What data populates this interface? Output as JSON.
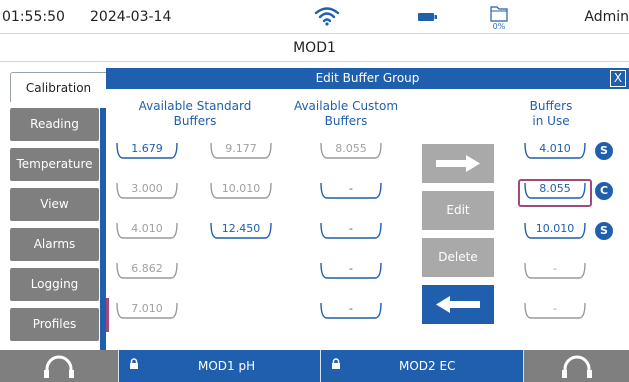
{
  "status": {
    "time": "01:55:50",
    "date": "2024-03-14",
    "storage_pct": "0%",
    "user": "Admin"
  },
  "title": "MOD1",
  "sidebar": {
    "active_tab": "Calibration",
    "items": [
      "Reading",
      "Temperature",
      "View",
      "Alarms",
      "Logging",
      "Profiles"
    ]
  },
  "dialog": {
    "title": "Edit Buffer Group",
    "close": "X",
    "headers": {
      "standard": [
        "Available Standard",
        "Buffers"
      ],
      "custom": [
        "Available Custom",
        "Buffers"
      ],
      "in_use": [
        "Buffers",
        "in Use"
      ]
    },
    "standard_col1": [
      {
        "value": "1.679",
        "active": true
      },
      {
        "value": "3.000",
        "active": false
      },
      {
        "value": "4.010",
        "active": false
      },
      {
        "value": "6.862",
        "active": false
      },
      {
        "value": "7.010",
        "active": false
      }
    ],
    "standard_col2": [
      {
        "value": "9.177",
        "active": false
      },
      {
        "value": "10.010",
        "active": false
      },
      {
        "value": "12.450",
        "active": true
      }
    ],
    "custom": [
      "8.055",
      "-",
      "-",
      "-",
      "-"
    ],
    "in_use": [
      {
        "value": "4.010",
        "badge": "S"
      },
      {
        "value": "8.055",
        "badge": "C"
      },
      {
        "value": "10.010",
        "badge": "S"
      },
      {
        "value": "-",
        "badge": ""
      },
      {
        "value": "-",
        "badge": ""
      }
    ],
    "buttons": {
      "edit": "Edit",
      "delete": "Delete"
    }
  },
  "footer": {
    "module1": "MOD1 pH",
    "module2": "MOD2 EC"
  },
  "colors": {
    "accent": "#1f5fae",
    "disabled": "#a9a9a9",
    "highlight": "#a0497a"
  }
}
